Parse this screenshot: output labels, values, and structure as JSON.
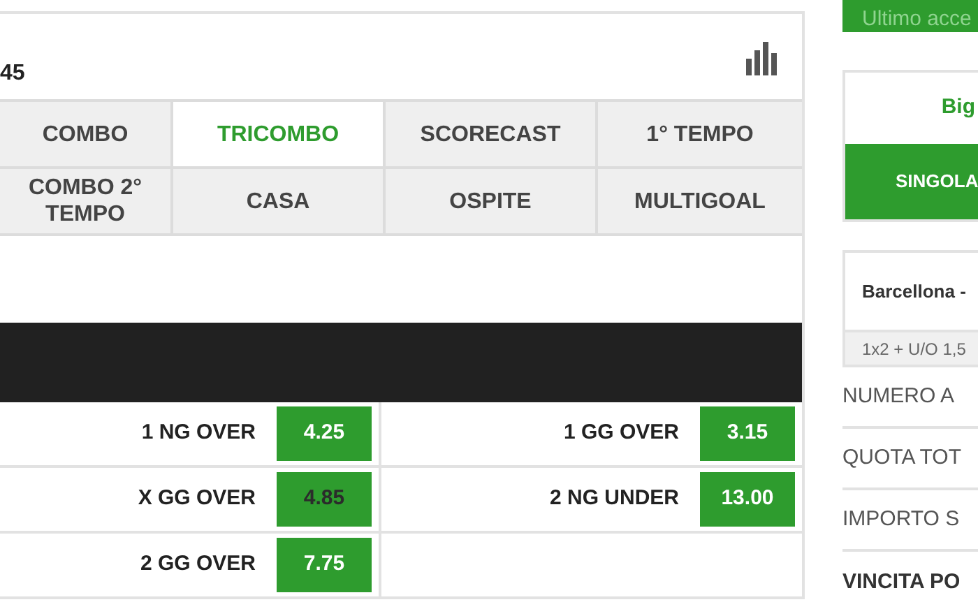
{
  "event": {
    "time": "45"
  },
  "tabs": [
    {
      "label": "COMBO",
      "selected": false
    },
    {
      "label": "TRICOMBO",
      "selected": true
    },
    {
      "label": "SCORECAST",
      "selected": false
    },
    {
      "label": "1° TEMPO",
      "selected": false
    },
    {
      "label": "COMBO 2° TEMPO",
      "selected": false
    },
    {
      "label": "CASA",
      "selected": false
    },
    {
      "label": "OSPITE",
      "selected": false
    },
    {
      "label": "MULTIGOAL",
      "selected": false
    }
  ],
  "odds": [
    {
      "label": "1 NG OVER",
      "odd": "4.25",
      "selected": false
    },
    {
      "label": "1 GG OVER",
      "odd": "3.15",
      "selected": false
    },
    {
      "label": "X GG OVER",
      "odd": "4.85",
      "selected": true
    },
    {
      "label": "2 NG UNDER",
      "odd": "13.00",
      "selected": false
    },
    {
      "label": "2 GG OVER",
      "odd": "7.75",
      "selected": false
    }
  ],
  "sidebar": {
    "banner": "Ultimo acce",
    "bet_title": "Big",
    "bet_tab": "SINGOLA",
    "match": "Barcellona -",
    "market": "1x2 + U/O 1,5",
    "summary": [
      {
        "label": "NUMERO A",
        "bold": false
      },
      {
        "label": "QUOTA TOT",
        "bold": false
      },
      {
        "label": "IMPORTO S",
        "bold": false
      },
      {
        "label": "VINCITA PO",
        "bold": true
      }
    ]
  }
}
